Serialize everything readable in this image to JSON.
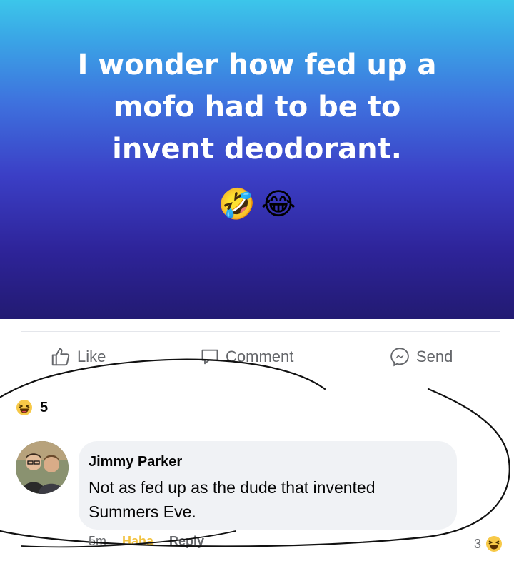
{
  "post": {
    "lines": [
      "I wonder how fed up a",
      "mofo had to be to",
      "invent deodorant."
    ],
    "emojis": [
      "🤣",
      "😂"
    ]
  },
  "actions": {
    "like": "Like",
    "comment": "Comment",
    "send": "Send"
  },
  "reactions": {
    "count": "5"
  },
  "comment": {
    "author": "Jimmy Parker",
    "text": "Not as fed up as the dude that invented Summers Eve.",
    "time": "5m",
    "haha": "Haha",
    "reply": "Reply",
    "reaction_count": "3"
  }
}
